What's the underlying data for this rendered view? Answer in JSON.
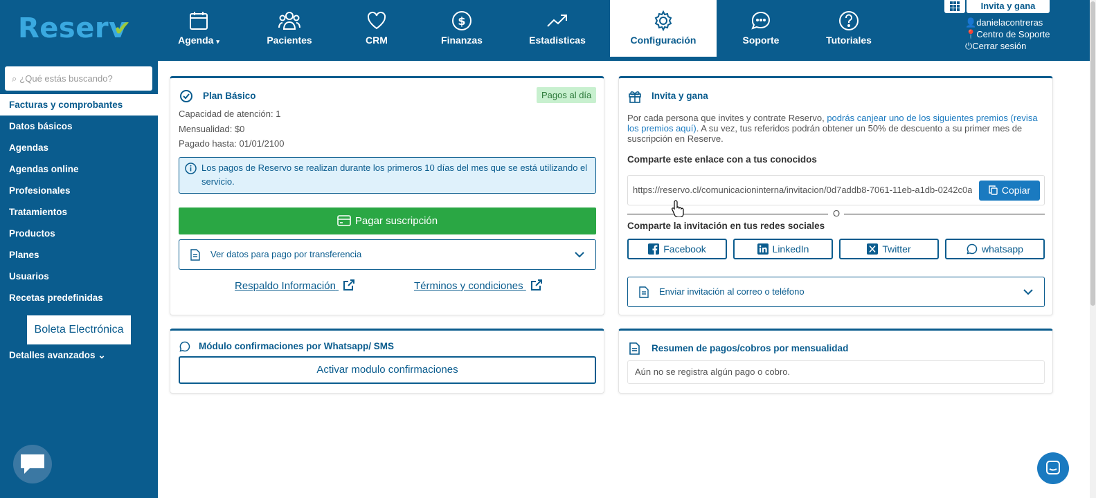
{
  "brand": {
    "name": "Reserv",
    "accent": "#0a5c8e",
    "check_color": "#9dc93b"
  },
  "nav": [
    {
      "label": "Agenda",
      "icon": "calendar-icon",
      "dropdown": true
    },
    {
      "label": "Pacientes",
      "icon": "users-icon"
    },
    {
      "label": "CRM",
      "icon": "heart-icon"
    },
    {
      "label": "Finanzas",
      "icon": "dollar-icon"
    },
    {
      "label": "Estadisticas",
      "icon": "trend-icon"
    },
    {
      "label": "Configuración",
      "icon": "gear-icon",
      "active": true
    },
    {
      "label": "Soporte",
      "icon": "chat-icon"
    },
    {
      "label": "Tutoriales",
      "icon": "help-icon"
    }
  ],
  "user": {
    "invite_label": "Invita y gana",
    "username": "danielacontreras",
    "support": "Centro de Soporte",
    "logout": "Cerrar sesión"
  },
  "sidebar": {
    "search_placeholder": "¿Qué estás buscando?",
    "items": [
      {
        "label": "Facturas y comprobantes",
        "active": true
      },
      {
        "label": "Datos básicos"
      },
      {
        "label": "Agendas"
      },
      {
        "label": "Agendas online"
      },
      {
        "label": "Profesionales"
      },
      {
        "label": "Tratamientos"
      },
      {
        "label": "Productos"
      },
      {
        "label": "Planes"
      },
      {
        "label": "Usuarios"
      },
      {
        "label": "Recetas predefinidas"
      }
    ],
    "boleta": "Boleta Electrónica",
    "detalles": "Detalles avanzados"
  },
  "plan": {
    "title": "Plan Básico",
    "status": "Pagos al día",
    "capacidad": "Capacidad de atención: 1",
    "mensualidad": "Mensualidad: $0",
    "pagado": "Pagado hasta: 01/01/2100",
    "info": "Los pagos de Reservo se realizan durante los primeros 10 días del mes que se está utilizando el servicio.",
    "pay_button": "Pagar suscripción",
    "transfer": "Ver datos para pago por transferencia",
    "respaldo": "Respaldo Información",
    "terminos": "Términos y condiciones"
  },
  "modulo": {
    "title": "Módulo confirmaciones por Whatsapp/ SMS",
    "button": "Activar modulo confirmaciones"
  },
  "invite": {
    "title": "Invita y gana",
    "desc_pre": "Por cada persona que invites y contrate Reservo, ",
    "desc_link": "podrás canjear uno de los siguientes premios (revisa los premios aquí)",
    "desc_post": ". A su vez, tus referidos podrán obtener un 50% de descuento a su primer mes de suscripción en Reserve.",
    "share_label": "Comparte este enlace con a tus conocidos",
    "url": "https://reservo.cl/comunicacioninterna/invitacion/0d7addb8-7061-11eb-a1db-0242c0a",
    "copy": "Copiar",
    "or": "O",
    "social_label": "Comparte la invitación en tus redes sociales",
    "socials": [
      "Facebook",
      "LinkedIn",
      "Twitter",
      "whatsapp"
    ],
    "send": "Enviar invitación al correo o teléfono"
  },
  "resumen": {
    "title": "Resumen de pagos/cobros por mensualidad",
    "empty": "Aún no se registra algún pago o cobro."
  }
}
